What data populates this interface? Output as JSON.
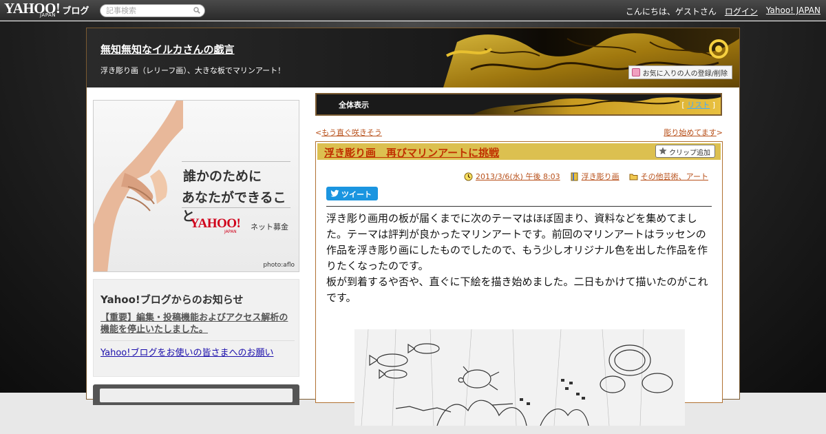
{
  "topbar": {
    "logo_text": "YAHOO!",
    "logo_sub": "JAPAN",
    "logo_blog": "ブログ",
    "search_placeholder": "記事検索",
    "greeting": "こんにちは、ゲストさん",
    "login_label": "ログイン",
    "yahoo_japan_label": "Yahoo! JAPAN"
  },
  "header": {
    "blog_title": "無知無知なイルカさんの戯言",
    "blog_subtitle": "浮き彫り画（レリーフ画）、大きな板でマリンアート！",
    "favorite_button": "お気に入りの人の登録/削除"
  },
  "sidebar": {
    "ad": {
      "line1": "誰かのために",
      "line2": "あなたができること",
      "logo_text": "YAHOO!",
      "logo_sub": "JAPAN",
      "service": "ネット募金",
      "credit": "photo:aflo"
    },
    "notice": {
      "heading": "Yahoo!ブログからのお知らせ",
      "item1": "【重要】編集・投稿機能およびアクセス解析の機能を停止いたしました。",
      "item2": "Yahoo!ブログをお使いの皆さまへのお願い"
    }
  },
  "content": {
    "viewbar": {
      "title": "全体表示",
      "list_open": "[ ",
      "list_label": "リスト",
      "list_close": " ]"
    },
    "nav": {
      "prev_arrow": "<",
      "prev_label": "もう直ぐ咲きそう",
      "next_label": "彫り始めてます",
      "next_arrow": ">"
    },
    "article": {
      "title": "浮き彫り画　再びマリンアートに挑戦",
      "clip_button": "クリップ追加",
      "date": "2013/3/6(水) 午後 8:03",
      "category1": "浮き彫り画",
      "category2": "その他芸術、アート",
      "tweet_label": "ツイート",
      "paragraph1": "浮き彫り画用の板が届くまでに次のテーマはほぼ固まり、資料などを集めてました。テーマは評判が良かったマリンアートです。前回のマリンアートはラッセンの作品を浮き彫り画にしたものでしたので、もう少しオリジナル色を出した作品を作りたくなったのです。",
      "paragraph2": "板が到着するや否や、直ぐに下絵を描き始めました。二日もかけて描いたのがこれです。"
    }
  },
  "colors": {
    "link_orange": "#b8501a",
    "title_red": "#c03000",
    "titlebar_gold": "#dcc050",
    "tweet_blue": "#1b95e0",
    "frame_brown": "#7a5a30"
  }
}
